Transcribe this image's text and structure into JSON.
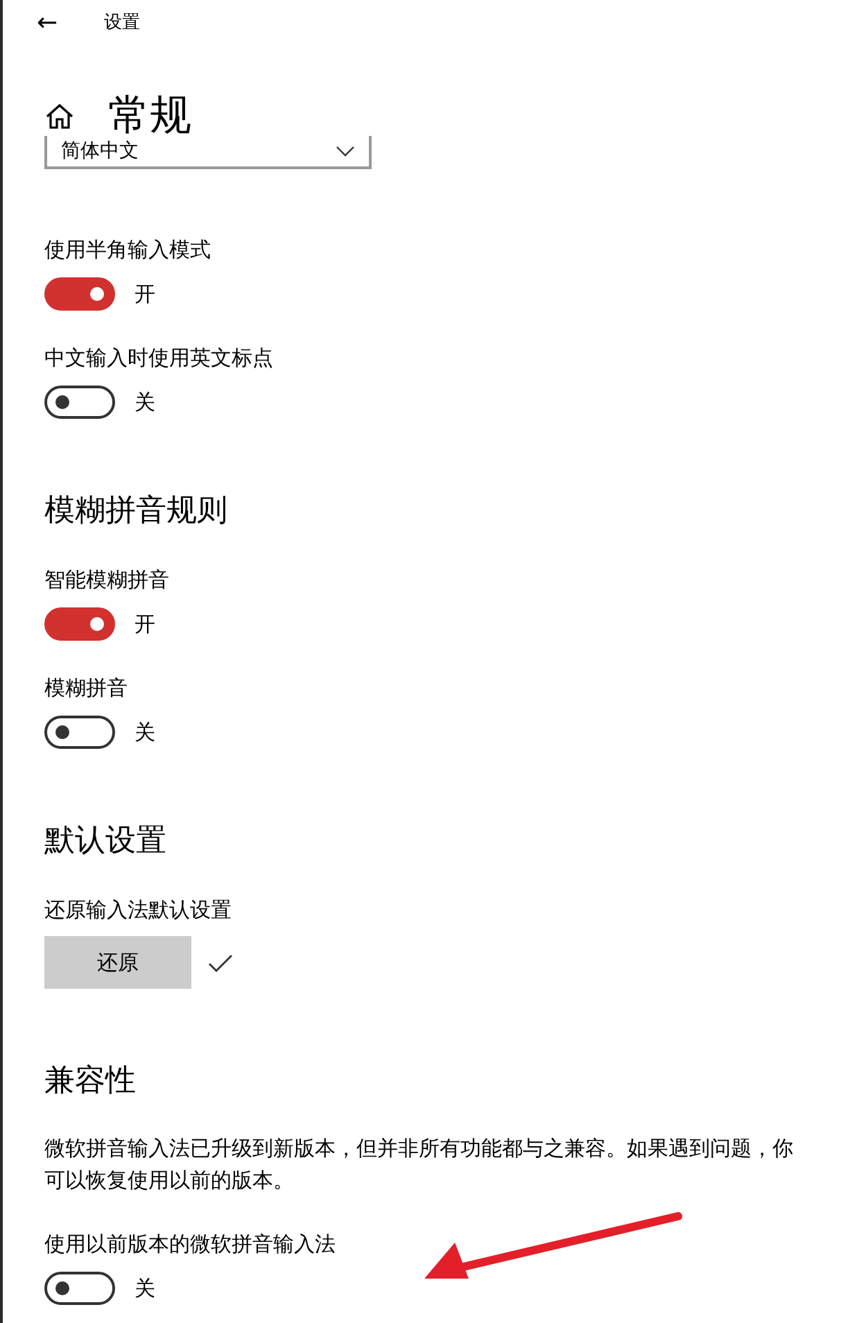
{
  "header": {
    "back": "←",
    "title": "设置"
  },
  "page_title": "常规",
  "language_dropdown": {
    "value": "简体中文"
  },
  "sections": [
    {
      "settings": [
        {
          "kind": "toggle",
          "label": "使用半角输入模式",
          "on": true,
          "state_text": "开"
        },
        {
          "kind": "toggle",
          "label": "中文输入时使用英文标点",
          "on": false,
          "state_text": "关"
        }
      ]
    },
    {
      "heading": "模糊拼音规则",
      "settings": [
        {
          "kind": "toggle",
          "label": "智能模糊拼音",
          "on": true,
          "state_text": "开"
        },
        {
          "kind": "toggle",
          "label": "模糊拼音",
          "on": false,
          "state_text": "关"
        }
      ]
    },
    {
      "heading": "默认设置",
      "settings": [
        {
          "kind": "button",
          "label": "还原输入法默认设置",
          "button": "还原",
          "done": true
        }
      ]
    },
    {
      "heading": "兼容性",
      "description": "微软拼音输入法已升级到新版本，但并非所有功能都与之兼容。如果遇到问题，你可以恢复使用以前的版本。",
      "settings": [
        {
          "kind": "toggle",
          "label": "使用以前版本的微软拼音输入法",
          "on": false,
          "state_text": "关"
        }
      ]
    }
  ]
}
